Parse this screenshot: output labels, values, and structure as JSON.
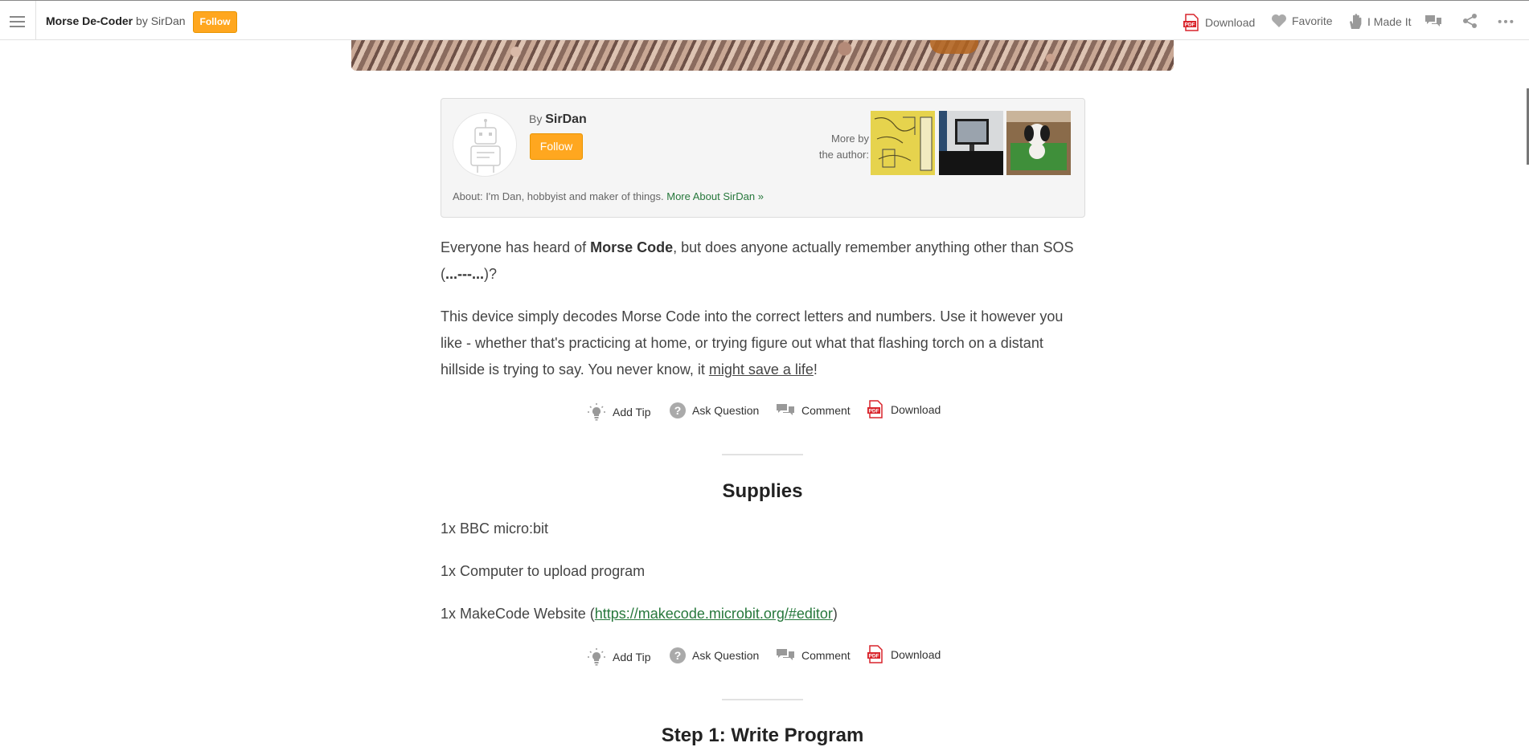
{
  "topbar": {
    "project_title": "Morse De-Coder",
    "by": "by",
    "author": "SirDan",
    "follow_label": "Follow",
    "download_label": "Download",
    "favorite_label": "Favorite",
    "made_it_label": "I Made It",
    "pdf_badge": "PDF"
  },
  "author_box": {
    "by_prefix": "By",
    "author_name": "SirDan",
    "follow_label": "Follow",
    "more_by_line1": "More by",
    "more_by_line2": "the author:",
    "about_text": "About: I'm Dan, hobbyist and maker of things.",
    "more_about_link": "More About SirDan »"
  },
  "intro": {
    "p1_before": "Everyone has heard of ",
    "p1_bold": "Morse Code",
    "p1_after": ", but does anyone actually remember anything other than SOS (",
    "p1_sos": "...---...",
    "p1_end": ")?",
    "p2_text": "This device simply decodes Morse Code into the correct letters and numbers. Use it however you like - whether that's practicing at home, or trying figure out what that flashing torch on a distant hillside is trying to say. You never know, it ",
    "p2_link": "might save a life",
    "p2_end": "!"
  },
  "action_bar": {
    "add_tip": "Add Tip",
    "ask_question": "Ask Question",
    "comment": "Comment",
    "download": "Download",
    "pdf_badge": "PDF"
  },
  "supplies": {
    "heading": "Supplies",
    "item1": "1x BBC micro:bit",
    "item2": "1x Computer to upload program",
    "item3_before": "1x MakeCode Website (",
    "item3_link": "https://makecode.microbit.org/#editor",
    "item3_after": ")"
  },
  "step1": {
    "heading": "Step 1: Write Program"
  },
  "colors": {
    "follow_orange": "#ffa71f",
    "link_green": "#27783c",
    "pdf_red": "#d9242b"
  }
}
